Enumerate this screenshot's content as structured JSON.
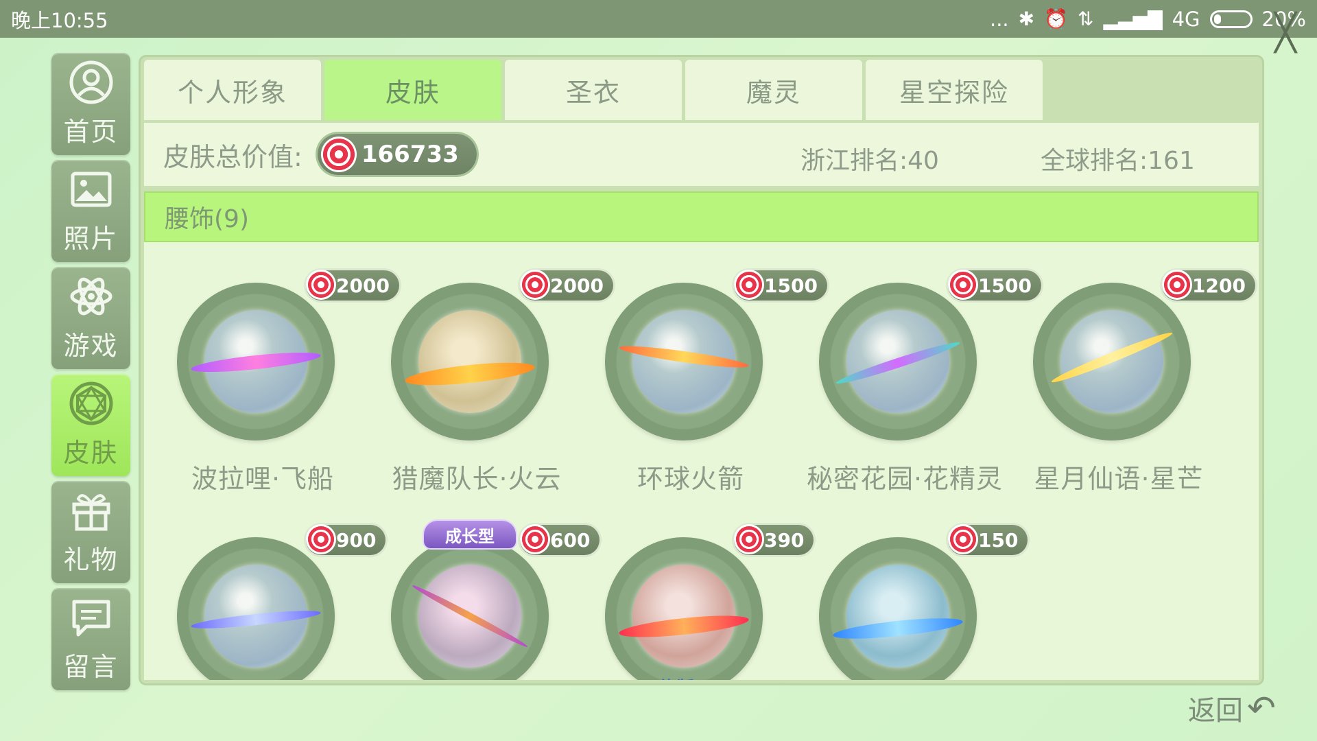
{
  "status": {
    "time": "晚上10:55",
    "dots": "...",
    "network": "4G",
    "battery_percent": "20%",
    "battery_level": 0.2
  },
  "sidebar": {
    "items": [
      {
        "label": "首页",
        "icon": "user-circle-icon",
        "active": false
      },
      {
        "label": "照片",
        "icon": "picture-icon",
        "active": false
      },
      {
        "label": "游戏",
        "icon": "atom-icon",
        "active": false
      },
      {
        "label": "皮肤",
        "icon": "gem-icon",
        "active": true
      },
      {
        "label": "礼物",
        "icon": "gift-icon",
        "active": false
      },
      {
        "label": "留言",
        "icon": "message-icon",
        "active": false
      }
    ]
  },
  "tabs": [
    {
      "label": "个人形象",
      "active": false
    },
    {
      "label": "皮肤",
      "active": true
    },
    {
      "label": "圣衣",
      "active": false
    },
    {
      "label": "魔灵",
      "active": false
    },
    {
      "label": "星空探险",
      "active": false
    }
  ],
  "summary": {
    "label": "皮肤总价值:",
    "value": "166733",
    "zhejiang_rank": "浙江排名:40",
    "global_rank": "全球排名:161"
  },
  "section": {
    "title": "腰饰(9)"
  },
  "items": [
    {
      "name": "波拉哩·飞船",
      "price": "2000",
      "colors": [
        "#b25cff",
        "#ff7fe0"
      ]
    },
    {
      "name": "猎魔队长·火云",
      "price": "2000",
      "colors": [
        "#ff8a1f",
        "#ffd24a"
      ]
    },
    {
      "name": "环球火箭",
      "price": "1500",
      "colors": [
        "#ff6a3c",
        "#ffd85a"
      ]
    },
    {
      "name": "秘密花园·花精灵",
      "price": "1500",
      "colors": [
        "#4fd9c7",
        "#d46bff"
      ]
    },
    {
      "name": "星月仙语·星芒",
      "price": "1200",
      "colors": [
        "#ffd447",
        "#fff1a0"
      ]
    },
    {
      "name": "",
      "price": "900",
      "colors": [
        "#6c6bff",
        "#c7d7ff"
      ]
    },
    {
      "name": "",
      "price": "600",
      "badge": "成长型",
      "colors": [
        "#b34ad4",
        "#f5a24a"
      ]
    },
    {
      "name": "",
      "price": "390",
      "bottom_tag": "绝版",
      "colors": [
        "#ff2f4f",
        "#ffb05a"
      ]
    },
    {
      "name": "",
      "price": "150",
      "colors": [
        "#2f86ff",
        "#9fe2ff"
      ]
    }
  ],
  "back": {
    "label": "返回",
    "icon": "back-arrow-icon"
  }
}
